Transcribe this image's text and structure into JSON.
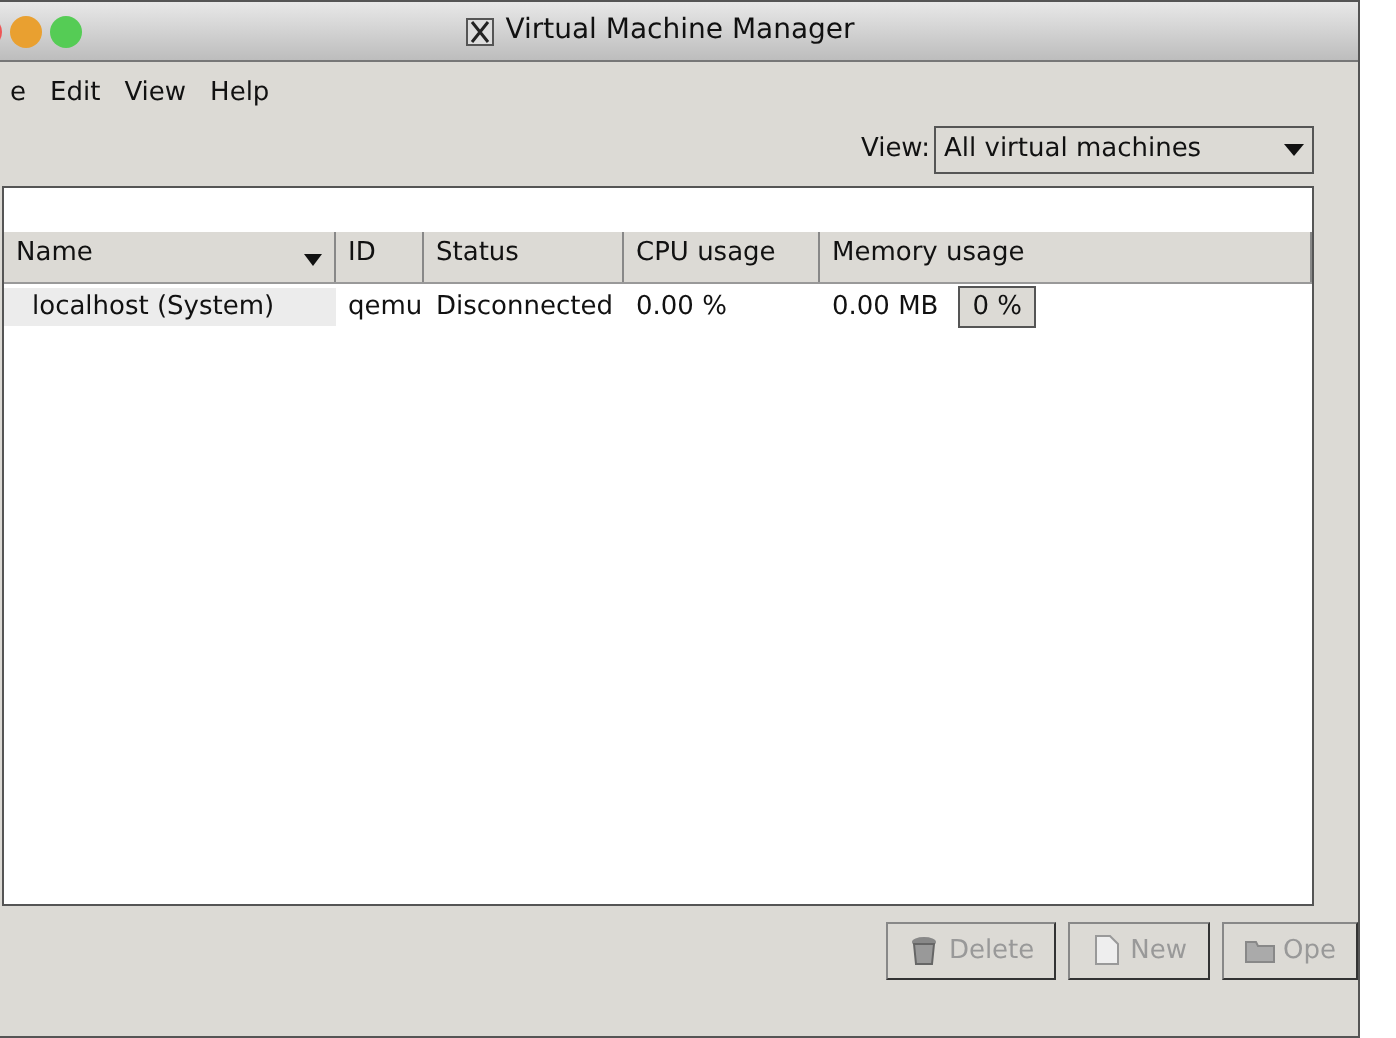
{
  "window": {
    "title": "Virtual Machine Manager"
  },
  "menu": [
    "e",
    "Edit",
    "View",
    "Help"
  ],
  "view_filter": {
    "label": "View:",
    "value": "All virtual machines"
  },
  "table": {
    "columns": [
      {
        "label": "Name",
        "sorted": true
      },
      {
        "label": "ID",
        "sorted": false
      },
      {
        "label": "Status",
        "sorted": false
      },
      {
        "label": "CPU usage",
        "sorted": false
      },
      {
        "label": "Memory usage",
        "sorted": false
      }
    ],
    "rows": [
      {
        "name": "localhost (System)",
        "id": "qemu",
        "status": "Disconnected",
        "cpu": "0.00 %",
        "memory": "0.00 MB",
        "memory_percent": "0 %",
        "level": 0
      }
    ]
  },
  "buttons": [
    {
      "label": "Delete",
      "kind": "delete",
      "disabled": true
    },
    {
      "label": "New",
      "kind": "new",
      "disabled": true
    },
    {
      "label": "Ope",
      "kind": "open",
      "disabled": true
    }
  ]
}
